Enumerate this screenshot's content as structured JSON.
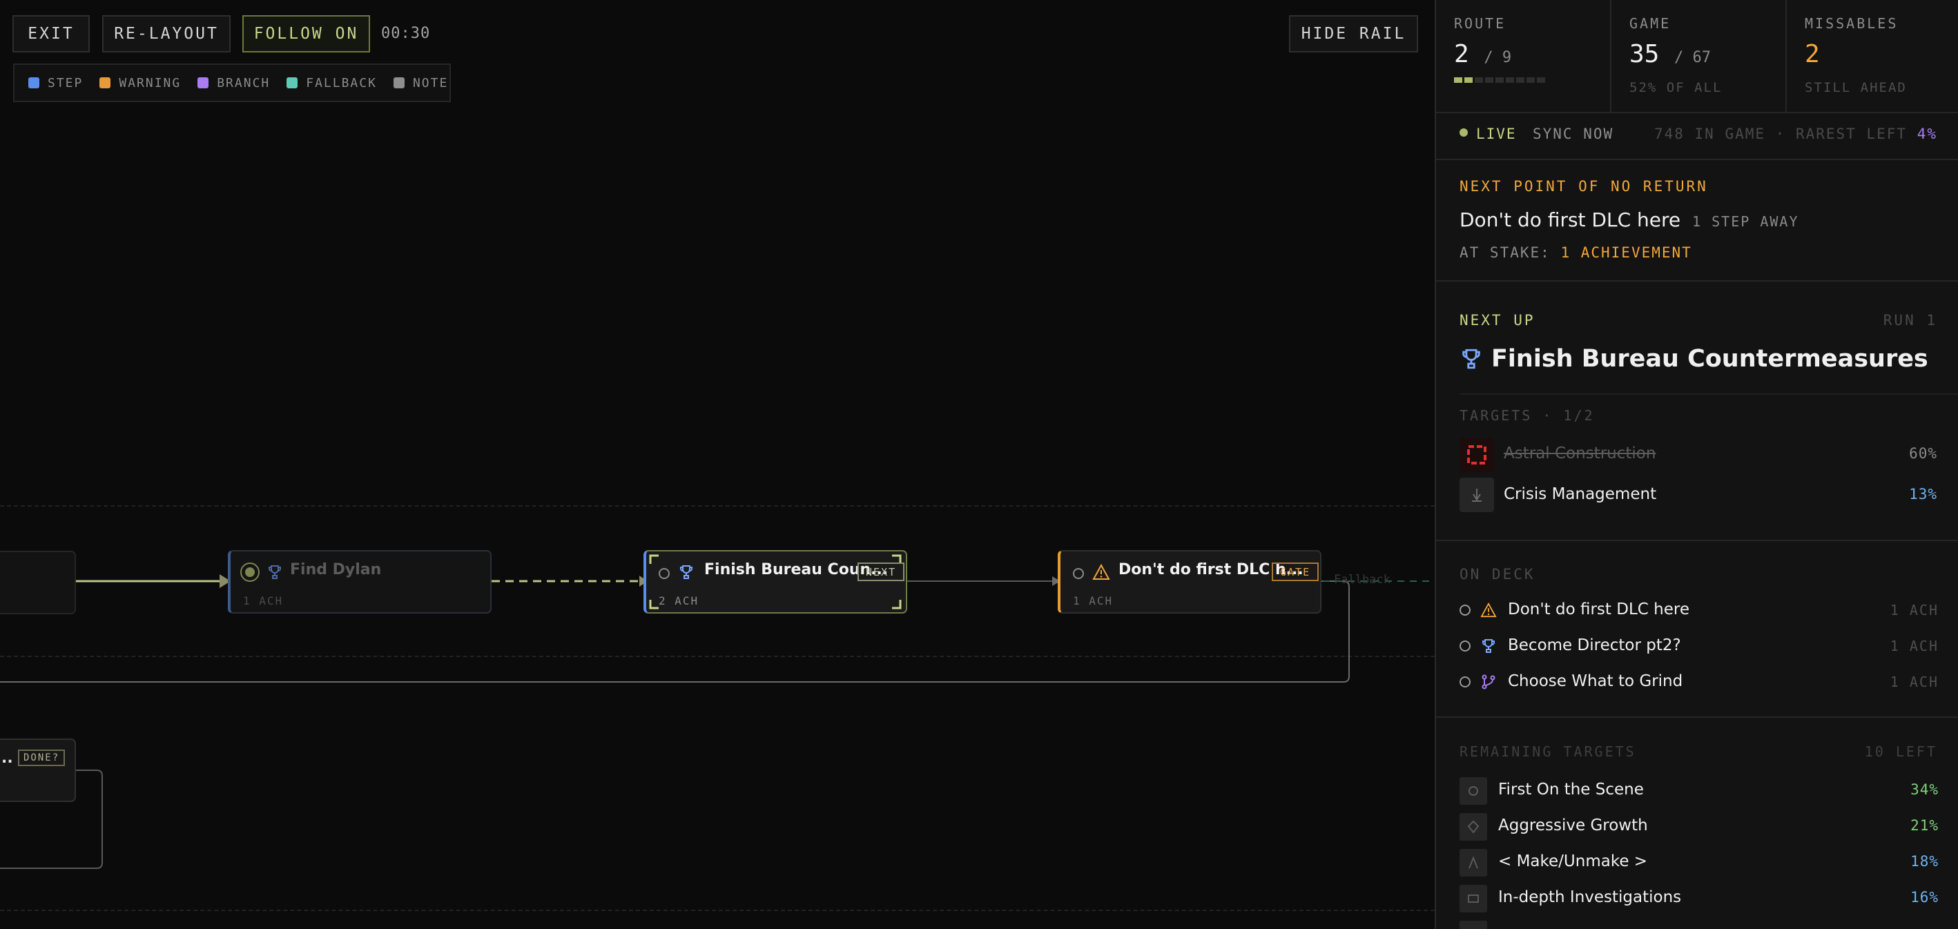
{
  "toolbar": {
    "exit_label": "EXIT",
    "relayout_label": "RE-LAYOUT",
    "follow_label": "FOLLOW ON",
    "timer": "00:30",
    "hide_rail_label": "HIDE RAIL"
  },
  "legend": [
    {
      "label": "STEP",
      "color": "#5b8def"
    },
    {
      "label": "WARNING",
      "color": "#e99a3c"
    },
    {
      "label": "BRANCH",
      "color": "#a97cf2"
    },
    {
      "label": "FALLBACK",
      "color": "#5ccab4"
    },
    {
      "label": "NOTE",
      "color": "#8e8e8e"
    }
  ],
  "graph": {
    "nodes": {
      "find_dylan": {
        "title": "Find Dylan",
        "sub": "1 ACH"
      },
      "finish_bureau": {
        "title": "Finish Bureau Coun...",
        "sub": "2 ACH",
        "tag": "NEXT"
      },
      "dont_dlc": {
        "title": "Don't do first DLC h...",
        "sub": "1 ACH",
        "tag": "GATE"
      },
      "lower_partial": {
        "title": "..",
        "tag": "DONE?"
      }
    },
    "fallback_label": "Fallback"
  },
  "rail": {
    "route": {
      "label": "ROUTE",
      "value": "2",
      "of": "/ 9",
      "progress": 0.222
    },
    "game": {
      "label": "GAME",
      "value": "35",
      "of": "/ 67",
      "foot": "52% OF ALL"
    },
    "missables": {
      "label": "MISSABLES",
      "value": "2",
      "foot": "STILL AHEAD"
    },
    "status": {
      "live": "LIVE",
      "sync": "SYNC NOW",
      "info": "748 IN GAME · RAREST LEFT",
      "rarest": "4%"
    },
    "ponr": {
      "heading": "NEXT POINT OF NO RETURN",
      "title": "Don't do first DLC here",
      "distance": "1 STEP AWAY",
      "stake_label": "AT STAKE:",
      "stake_value": "1 ACHIEVEMENT"
    },
    "next_up": {
      "heading": "NEXT UP",
      "run": "RUN 1",
      "title": "Finish Bureau Countermeasures",
      "targets_label": "TARGETS · 1/2",
      "targets": [
        {
          "name": "Astral Construction",
          "pct": "60%",
          "done": true
        },
        {
          "name": "Crisis Management",
          "pct": "13%",
          "done": false
        }
      ]
    },
    "on_deck": {
      "heading": "ON DECK",
      "items": [
        {
          "name": "Don't do first DLC here",
          "ach": "1 ACH",
          "icon": "warning-icon"
        },
        {
          "name": "Become Director pt2?",
          "ach": "1 ACH",
          "icon": "trophy-icon"
        },
        {
          "name": "Choose What to Grind",
          "ach": "1 ACH",
          "icon": "branch-icon"
        }
      ]
    },
    "remaining": {
      "heading": "REMAINING TARGETS",
      "count": "10 LEFT",
      "items": [
        {
          "name": "First On the Scene",
          "pct": "34%",
          "color": "#7fd07a"
        },
        {
          "name": "Aggressive Growth",
          "pct": "21%",
          "color": "#7fd07a"
        },
        {
          "name": "< Make/Unmake >",
          "pct": "18%",
          "color": "#6fb3f2"
        },
        {
          "name": "In-depth Investigations",
          "pct": "16%",
          "color": "#6fb3f2"
        }
      ]
    }
  },
  "colors": {
    "accent_green": "#c9d68a",
    "warning": "#f2a73b",
    "step_blue": "#5b8def",
    "branch_purple": "#a97cf2"
  }
}
